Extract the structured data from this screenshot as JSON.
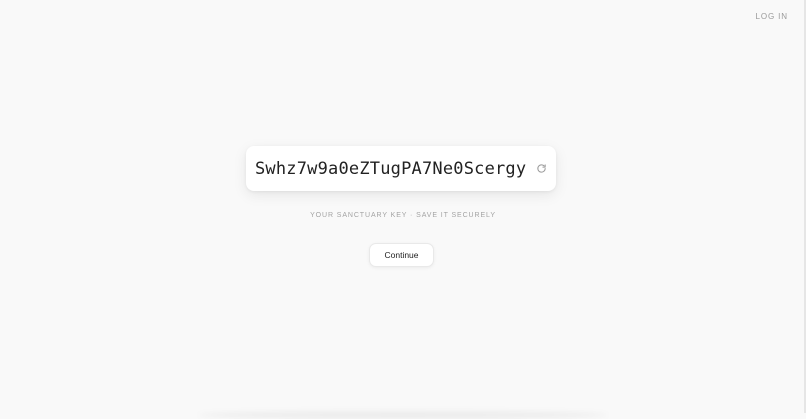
{
  "header": {
    "login_label": "LOG IN"
  },
  "key_card": {
    "key_value": "Swhz7w9a0eZTugPA7Ne0Scergy",
    "refresh_icon": "refresh-icon"
  },
  "caption": {
    "text": "YOUR SANCTUARY KEY · SAVE IT SECURELY"
  },
  "actions": {
    "continue_label": "Continue"
  },
  "colors": {
    "background": "#f9f9f9",
    "card": "#ffffff",
    "muted_text": "#a3a3a3"
  }
}
